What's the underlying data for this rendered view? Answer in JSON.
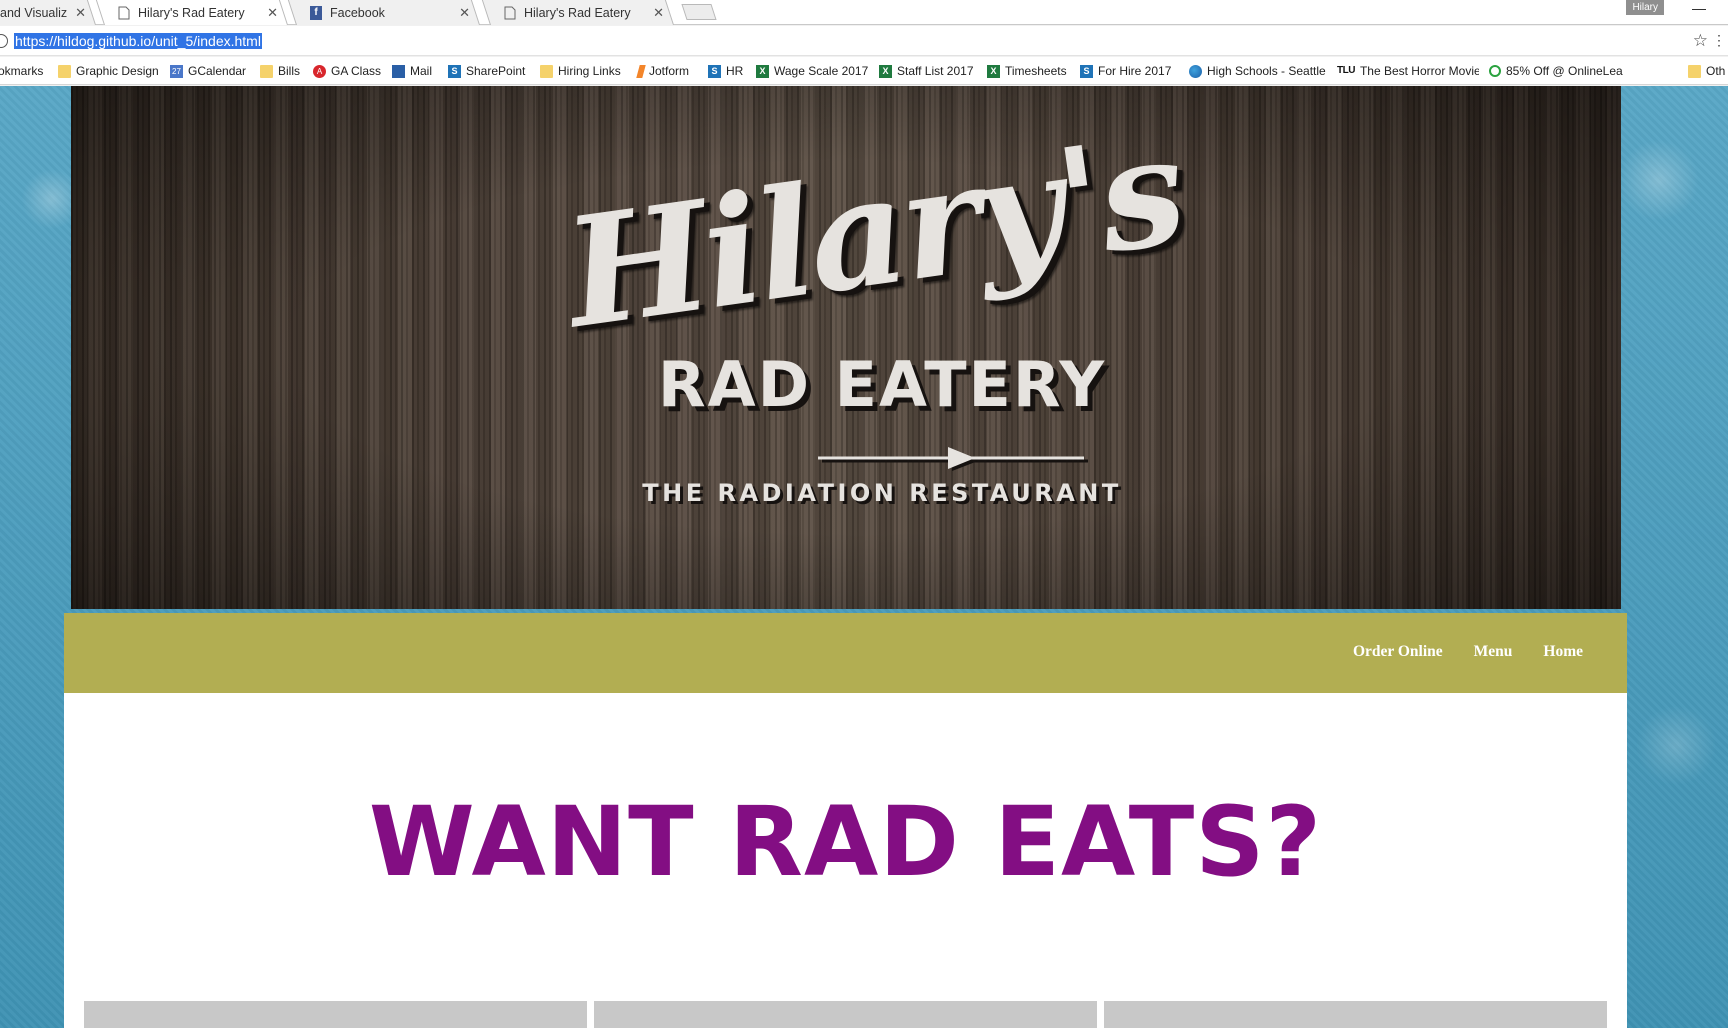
{
  "browser": {
    "tabs": [
      {
        "title": "and Visualiz",
        "active": false
      },
      {
        "title": "Hilary's Rad Eatery",
        "active": true
      },
      {
        "title": "Facebook",
        "active": false
      },
      {
        "title": "Hilary's Rad Eatery",
        "active": false
      }
    ],
    "user": "Hilary",
    "url": "https://hildog.github.io/unit_5/index.html",
    "bookmarks": [
      {
        "label": "okmarks",
        "icon": "folder-icon"
      },
      {
        "label": "Graphic Design",
        "icon": "folder-icon"
      },
      {
        "label": "GCalendar",
        "icon": "calendar-icon",
        "badge": "27"
      },
      {
        "label": "Bills",
        "icon": "folder-icon"
      },
      {
        "label": "GA Class",
        "icon": "ga-icon"
      },
      {
        "label": "Mail",
        "icon": "mail-icon"
      },
      {
        "label": "SharePoint",
        "icon": "sharepoint-icon"
      },
      {
        "label": "Hiring Links",
        "icon": "folder-icon"
      },
      {
        "label": "Jotform",
        "icon": "jotform-icon"
      },
      {
        "label": "HR",
        "icon": "sharepoint-icon"
      },
      {
        "label": "Wage Scale 2017",
        "icon": "excel-icon"
      },
      {
        "label": "Staff List 2017",
        "icon": "excel-icon"
      },
      {
        "label": "Timesheets",
        "icon": "excel-icon"
      },
      {
        "label": "For Hire 2017",
        "icon": "sharepoint-icon"
      },
      {
        "label": "High Schools - Seattle",
        "icon": "globe-icon"
      },
      {
        "label": "The Best Horror Movie",
        "icon": "tlu-icon"
      },
      {
        "label": "85% Off @ OnlineLea",
        "icon": "g-icon"
      },
      {
        "label": "Oth",
        "icon": "folder-icon"
      }
    ]
  },
  "page": {
    "logo": {
      "script": "Hilary's",
      "title": "RAD EATERY",
      "tagline": "THE RADIATION RESTAURANT"
    },
    "nav": [
      "Order Online",
      "Menu",
      "Home"
    ],
    "headline": "WANT RAD EATS?",
    "colors": {
      "nav_bar": "#b2ae52",
      "headline": "#830e83",
      "background": "#4a9dbd"
    }
  }
}
